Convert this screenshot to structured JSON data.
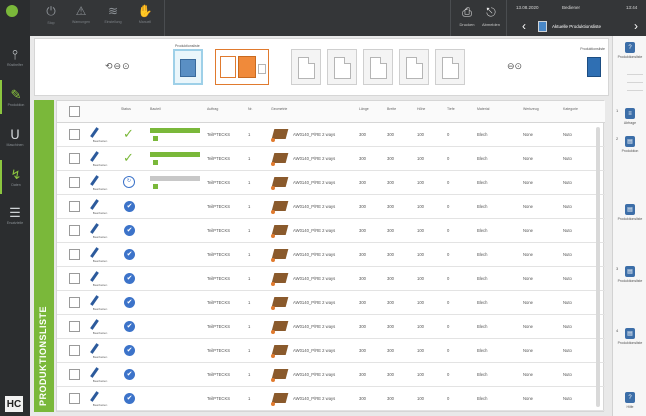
{
  "topbar": {
    "buttons": [
      {
        "label": "Stop",
        "icon": "power-icon"
      },
      {
        "label": "Warnungen",
        "icon": "warning-icon"
      },
      {
        "label": "Einstellung",
        "icon": "wifi-icon"
      },
      {
        "label": "Manuell",
        "icon": "hand-icon"
      }
    ],
    "right_buttons": [
      {
        "label": "Drucken",
        "icon": "export-icon"
      },
      {
        "label": "Abmelden",
        "icon": "logout-icon"
      }
    ],
    "date": "13.08.2020",
    "time": "13:44",
    "user": "Bediener",
    "title": "Aktuelle Produktionsliste"
  },
  "leftbar": {
    "items": [
      {
        "label": "Rüsthelfer",
        "icon": "clamp-icon",
        "active": false
      },
      {
        "label": "Produktion",
        "icon": "wrench-icon",
        "active": true
      },
      {
        "label": "Maschinen",
        "icon": "magnet-icon",
        "active": false
      },
      {
        "label": "Daten",
        "icon": "drop-icon",
        "active": false
      },
      {
        "label": "Ersatzteile",
        "icon": "sliders-icon",
        "active": false
      }
    ],
    "logo_text": "HC"
  },
  "strip": {
    "active_card_label": "Produktionsliste",
    "end_label": "Produktionsliste"
  },
  "right_panel": {
    "items": [
      {
        "num": "",
        "label": "Produktionsliste",
        "icon": "help-icon"
      },
      {
        "num": "1",
        "label": "Abfrage",
        "icon": "list-icon"
      },
      {
        "num": "2",
        "label": "Produktion",
        "icon": "doc-icon"
      },
      {
        "num": "",
        "label": "Produktionsliste",
        "icon": "doc-icon"
      },
      {
        "num": "3",
        "label": "Produktionsliste",
        "icon": "doc-icon"
      },
      {
        "num": "4",
        "label": "Produktionsliste",
        "icon": "doc-icon"
      },
      {
        "num": "",
        "label": "Hilfe",
        "icon": "help-icon"
      }
    ]
  },
  "vtab_label": "PRODUKTIONSLISTE",
  "table": {
    "headers": [
      "Status",
      "Bauteil",
      "Auftrag",
      "Nr.",
      "Geometrie",
      "Länge",
      "Breite",
      "Höhe",
      "Tiefe",
      "Material",
      "Werkzeug",
      "Kategorie"
    ],
    "rows": [
      {
        "status": "check",
        "progress": "full",
        "order": "TeilPTECKS",
        "qty": "1",
        "geom": "AW0140_P/RE 2 ways",
        "l": "300",
        "w": "300",
        "h": "100",
        "d": "0",
        "mat": "Blech",
        "tool": "None",
        "cat": "Nuto"
      },
      {
        "status": "check",
        "progress": "full",
        "order": "TeilPTECKS",
        "qty": "1",
        "geom": "AW0140_P/RE 2 ways",
        "l": "300",
        "w": "300",
        "h": "100",
        "d": "0",
        "mat": "Blech",
        "tool": "None",
        "cat": "Nuto"
      },
      {
        "status": "spin",
        "progress": "grey",
        "order": "TeilPTECKS",
        "qty": "1",
        "geom": "AW0140_P/RE 2 ways",
        "l": "300",
        "w": "300",
        "h": "100",
        "d": "0",
        "mat": "Blech",
        "tool": "None",
        "cat": "Nuto"
      },
      {
        "status": "blue",
        "progress": "",
        "order": "TeilPTECKS",
        "qty": "1",
        "geom": "AW0140_P/RE 2 ways",
        "l": "300",
        "w": "300",
        "h": "100",
        "d": "0",
        "mat": "Blech",
        "tool": "None",
        "cat": "Nuto"
      },
      {
        "status": "blue",
        "progress": "",
        "order": "TeilPTECKS",
        "qty": "1",
        "geom": "AW0140_P/RE 2 ways",
        "l": "300",
        "w": "300",
        "h": "100",
        "d": "0",
        "mat": "Blech",
        "tool": "None",
        "cat": "Nuto"
      },
      {
        "status": "blue",
        "progress": "",
        "order": "TeilPTECKS",
        "qty": "1",
        "geom": "AW0140_P/RE 2 ways",
        "l": "300",
        "w": "300",
        "h": "100",
        "d": "0",
        "mat": "Blech",
        "tool": "None",
        "cat": "Nuto"
      },
      {
        "status": "blue",
        "progress": "",
        "order": "TeilPTECKS",
        "qty": "1",
        "geom": "AW0140_P/RE 2 ways",
        "l": "300",
        "w": "300",
        "h": "100",
        "d": "0",
        "mat": "Blech",
        "tool": "None",
        "cat": "Nuto"
      },
      {
        "status": "blue",
        "progress": "",
        "order": "TeilPTECKS",
        "qty": "1",
        "geom": "AW0140_P/RE 2 ways",
        "l": "300",
        "w": "300",
        "h": "100",
        "d": "0",
        "mat": "Blech",
        "tool": "None",
        "cat": "Nuto"
      },
      {
        "status": "blue",
        "progress": "",
        "order": "TeilPTECKS",
        "qty": "1",
        "geom": "AW0140_P/RE 2 ways",
        "l": "300",
        "w": "300",
        "h": "100",
        "d": "0",
        "mat": "Blech",
        "tool": "None",
        "cat": "Nuto"
      },
      {
        "status": "blue",
        "progress": "",
        "order": "TeilPTECKS",
        "qty": "1",
        "geom": "AW0140_P/RE 2 ways",
        "l": "300",
        "w": "300",
        "h": "100",
        "d": "0",
        "mat": "Blech",
        "tool": "None",
        "cat": "Nuto"
      },
      {
        "status": "blue",
        "progress": "",
        "order": "TeilPTECKS",
        "qty": "1",
        "geom": "AW0140_P/RE 2 ways",
        "l": "300",
        "w": "300",
        "h": "100",
        "d": "0",
        "mat": "Blech",
        "tool": "None",
        "cat": "Nuto"
      },
      {
        "status": "blue",
        "progress": "",
        "order": "TeilPTECKS",
        "qty": "1",
        "geom": "AW0140_P/RE 2 ways",
        "l": "300",
        "w": "300",
        "h": "100",
        "d": "0",
        "mat": "Blech",
        "tool": "None",
        "cat": "Nuto"
      }
    ],
    "edit_label": "Bearbeiten"
  },
  "colors": {
    "accent_green": "#7ab83a",
    "status_blue": "#3c73c9",
    "topbar": "#343638",
    "sidebar": "#2b2d2f"
  }
}
